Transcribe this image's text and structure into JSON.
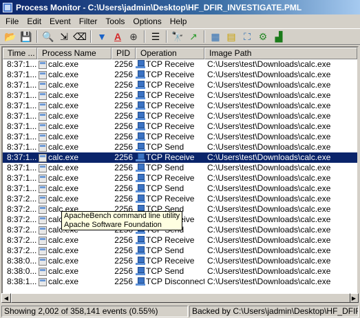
{
  "window": {
    "title": "Process Monitor - C:\\Users\\jadmin\\Desktop\\HF_DFIR_INVESTIGATE.PML"
  },
  "menu": [
    "File",
    "Edit",
    "Event",
    "Filter",
    "Tools",
    "Options",
    "Help"
  ],
  "toolbar": {
    "icons": [
      "open-icon",
      "save-icon",
      "sep",
      "capture-icon",
      "autoscroll-icon",
      "clear-icon",
      "sep",
      "filter-icon",
      "highlight-icon",
      "target-icon",
      "sep",
      "tree-icon",
      "sep",
      "find-icon",
      "jump-icon",
      "sep",
      "registry-icon",
      "filesystem-icon",
      "network-icon",
      "process-icon",
      "profiling-icon"
    ]
  },
  "columns": {
    "time": "Time ...",
    "process": "Process Name",
    "pid": "PID",
    "operation": "Operation",
    "path": "Image Path"
  },
  "rows": [
    {
      "time": "8:37:1...",
      "process": "calc.exe",
      "pid": "2256",
      "op": "TCP Receive",
      "path": "C:\\Users\\test\\Downloads\\calc.exe"
    },
    {
      "time": "8:37:1...",
      "process": "calc.exe",
      "pid": "2256",
      "op": "TCP Receive",
      "path": "C:\\Users\\test\\Downloads\\calc.exe"
    },
    {
      "time": "8:37:1...",
      "process": "calc.exe",
      "pid": "2256",
      "op": "TCP Receive",
      "path": "C:\\Users\\test\\Downloads\\calc.exe"
    },
    {
      "time": "8:37:1...",
      "process": "calc.exe",
      "pid": "2256",
      "op": "TCP Receive",
      "path": "C:\\Users\\test\\Downloads\\calc.exe"
    },
    {
      "time": "8:37:1...",
      "process": "calc.exe",
      "pid": "2256",
      "op": "TCP Receive",
      "path": "C:\\Users\\test\\Downloads\\calc.exe"
    },
    {
      "time": "8:37:1...",
      "process": "calc.exe",
      "pid": "2256",
      "op": "TCP Receive",
      "path": "C:\\Users\\test\\Downloads\\calc.exe"
    },
    {
      "time": "8:37:1...",
      "process": "calc.exe",
      "pid": "2256",
      "op": "TCP Receive",
      "path": "C:\\Users\\test\\Downloads\\calc.exe"
    },
    {
      "time": "8:37:1...",
      "process": "calc.exe",
      "pid": "2256",
      "op": "TCP Receive",
      "path": "C:\\Users\\test\\Downloads\\calc.exe"
    },
    {
      "time": "8:37:1...",
      "process": "calc.exe",
      "pid": "2256",
      "op": "TCP Send",
      "path": "C:\\Users\\test\\Downloads\\calc.exe"
    },
    {
      "time": "8:37:1...",
      "process": "calc.exe",
      "pid": "2256",
      "op": "TCP Receive",
      "path": "C:\\Users\\test\\Downloads\\calc.exe",
      "selected": true
    },
    {
      "time": "8:37:1...",
      "process": "calc.exe",
      "pid": "2256",
      "op": "TCP Send",
      "path": "C:\\Users\\test\\Downloads\\calc.exe"
    },
    {
      "time": "8:37:1...",
      "process": "calc.exe",
      "pid": "2256",
      "op": "TCP Receive",
      "path": "C:\\Users\\test\\Downloads\\calc.exe"
    },
    {
      "time": "8:37:1...",
      "process": "calc.exe",
      "pid": "2256",
      "op": "TCP Send",
      "path": "C:\\Users\\test\\Downloads\\calc.exe"
    },
    {
      "time": "8:37:2...",
      "process": "calc.exe",
      "pid": "2256",
      "op": "TCP Receive",
      "path": "C:\\Users\\test\\Downloads\\calc.exe"
    },
    {
      "time": "8:37:2...",
      "process": "calc.exe",
      "pid": "2256",
      "op": "TCP Send",
      "path": "C:\\Users\\test\\Downloads\\calc.exe"
    },
    {
      "time": "8:37:2...",
      "process": "calc.exe",
      "pid": "2256",
      "op": "TCP Receive",
      "path": "C:\\Users\\test\\Downloads\\calc.exe"
    },
    {
      "time": "8:37:2...",
      "process": "calc.exe",
      "pid": "2256",
      "op": "TCP Send",
      "path": "C:\\Users\\test\\Downloads\\calc.exe"
    },
    {
      "time": "8:37:2...",
      "process": "calc.exe",
      "pid": "2256",
      "op": "TCP Receive",
      "path": "C:\\Users\\test\\Downloads\\calc.exe"
    },
    {
      "time": "8:37:2...",
      "process": "calc.exe",
      "pid": "2256",
      "op": "TCP Send",
      "path": "C:\\Users\\test\\Downloads\\calc.exe"
    },
    {
      "time": "8:38:0...",
      "process": "calc.exe",
      "pid": "2256",
      "op": "TCP Receive",
      "path": "C:\\Users\\test\\Downloads\\calc.exe"
    },
    {
      "time": "8:38:0...",
      "process": "calc.exe",
      "pid": "2256",
      "op": "TCP Send",
      "path": "C:\\Users\\test\\Downloads\\calc.exe"
    },
    {
      "time": "8:38:1...",
      "process": "calc.exe",
      "pid": "2256",
      "op": "TCP Disconnect",
      "path": "C:\\Users\\test\\Downloads\\calc.exe"
    }
  ],
  "tooltip": {
    "line1": "ApacheBench command line utility",
    "line2": "Apache Software Foundation"
  },
  "status": {
    "events": "Showing 2,002 of 358,141 events (0.55%)",
    "backing": "Backed by C:\\Users\\jadmin\\Desktop\\HF_DFIR_INVE"
  }
}
